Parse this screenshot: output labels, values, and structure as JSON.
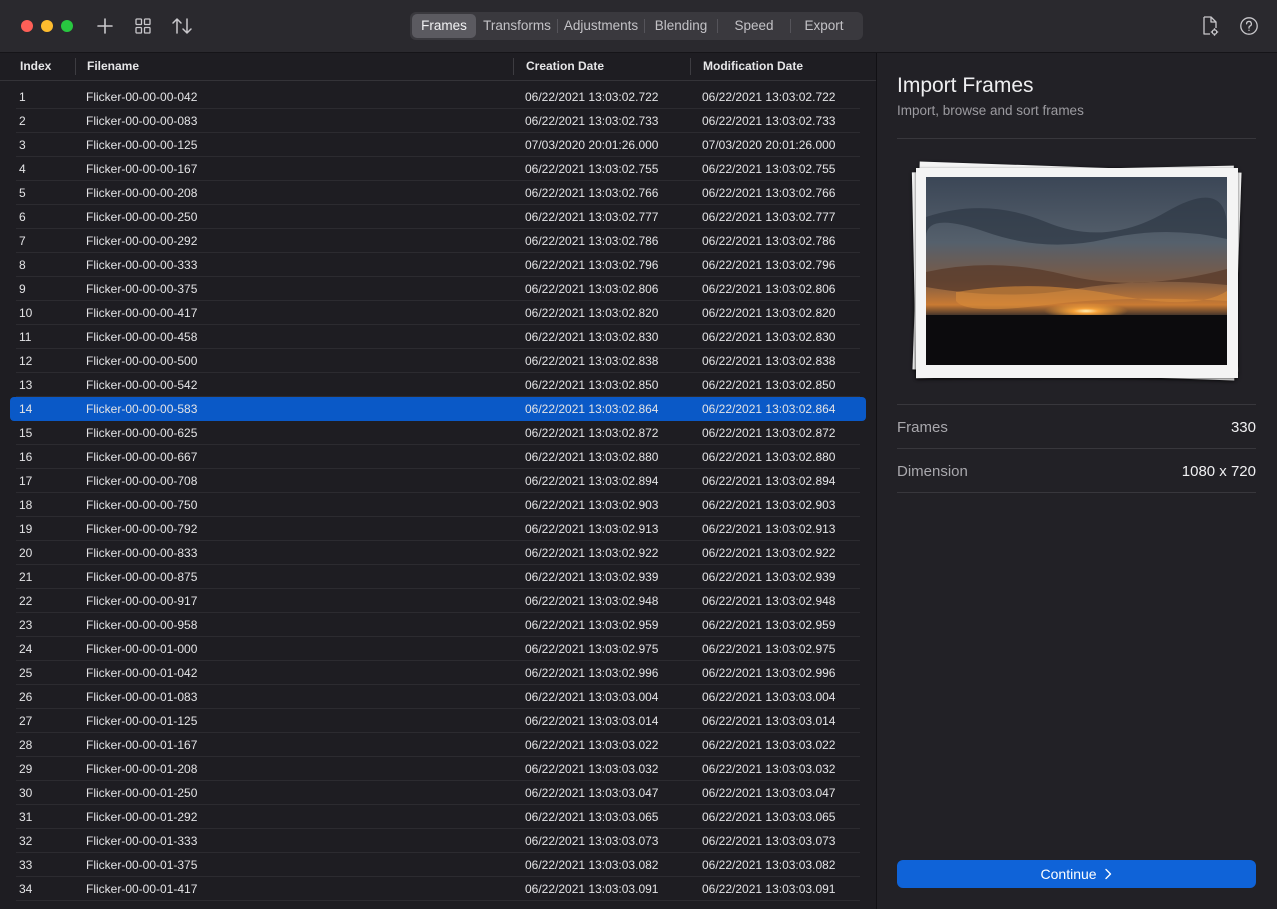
{
  "toolbar": {
    "tabs": [
      {
        "label": "Frames",
        "active": true
      },
      {
        "label": "Transforms",
        "active": false
      },
      {
        "label": "Adjustments",
        "active": false
      },
      {
        "label": "Blending",
        "active": false
      },
      {
        "label": "Speed",
        "active": false
      },
      {
        "label": "Export",
        "active": false
      }
    ],
    "icons": [
      "add-icon",
      "grid-icon",
      "sort-icon",
      "document-settings-icon",
      "help-icon"
    ]
  },
  "table": {
    "columns": [
      "Index",
      "Filename",
      "Creation Date",
      "Modification Date"
    ],
    "selected_index": "14",
    "rows": [
      [
        "1",
        "Flicker-00-00-00-042",
        "06/22/2021 13:03:02.722",
        "06/22/2021 13:03:02.722"
      ],
      [
        "2",
        "Flicker-00-00-00-083",
        "06/22/2021 13:03:02.733",
        "06/22/2021 13:03:02.733"
      ],
      [
        "3",
        "Flicker-00-00-00-125",
        "07/03/2020 20:01:26.000",
        "07/03/2020 20:01:26.000"
      ],
      [
        "4",
        "Flicker-00-00-00-167",
        "06/22/2021 13:03:02.755",
        "06/22/2021 13:03:02.755"
      ],
      [
        "5",
        "Flicker-00-00-00-208",
        "06/22/2021 13:03:02.766",
        "06/22/2021 13:03:02.766"
      ],
      [
        "6",
        "Flicker-00-00-00-250",
        "06/22/2021 13:03:02.777",
        "06/22/2021 13:03:02.777"
      ],
      [
        "7",
        "Flicker-00-00-00-292",
        "06/22/2021 13:03:02.786",
        "06/22/2021 13:03:02.786"
      ],
      [
        "8",
        "Flicker-00-00-00-333",
        "06/22/2021 13:03:02.796",
        "06/22/2021 13:03:02.796"
      ],
      [
        "9",
        "Flicker-00-00-00-375",
        "06/22/2021 13:03:02.806",
        "06/22/2021 13:03:02.806"
      ],
      [
        "10",
        "Flicker-00-00-00-417",
        "06/22/2021 13:03:02.820",
        "06/22/2021 13:03:02.820"
      ],
      [
        "11",
        "Flicker-00-00-00-458",
        "06/22/2021 13:03:02.830",
        "06/22/2021 13:03:02.830"
      ],
      [
        "12",
        "Flicker-00-00-00-500",
        "06/22/2021 13:03:02.838",
        "06/22/2021 13:03:02.838"
      ],
      [
        "13",
        "Flicker-00-00-00-542",
        "06/22/2021 13:03:02.850",
        "06/22/2021 13:03:02.850"
      ],
      [
        "14",
        "Flicker-00-00-00-583",
        "06/22/2021 13:03:02.864",
        "06/22/2021 13:03:02.864"
      ],
      [
        "15",
        "Flicker-00-00-00-625",
        "06/22/2021 13:03:02.872",
        "06/22/2021 13:03:02.872"
      ],
      [
        "16",
        "Flicker-00-00-00-667",
        "06/22/2021 13:03:02.880",
        "06/22/2021 13:03:02.880"
      ],
      [
        "17",
        "Flicker-00-00-00-708",
        "06/22/2021 13:03:02.894",
        "06/22/2021 13:03:02.894"
      ],
      [
        "18",
        "Flicker-00-00-00-750",
        "06/22/2021 13:03:02.903",
        "06/22/2021 13:03:02.903"
      ],
      [
        "19",
        "Flicker-00-00-00-792",
        "06/22/2021 13:03:02.913",
        "06/22/2021 13:03:02.913"
      ],
      [
        "20",
        "Flicker-00-00-00-833",
        "06/22/2021 13:03:02.922",
        "06/22/2021 13:03:02.922"
      ],
      [
        "21",
        "Flicker-00-00-00-875",
        "06/22/2021 13:03:02.939",
        "06/22/2021 13:03:02.939"
      ],
      [
        "22",
        "Flicker-00-00-00-917",
        "06/22/2021 13:03:02.948",
        "06/22/2021 13:03:02.948"
      ],
      [
        "23",
        "Flicker-00-00-00-958",
        "06/22/2021 13:03:02.959",
        "06/22/2021 13:03:02.959"
      ],
      [
        "24",
        "Flicker-00-00-01-000",
        "06/22/2021 13:03:02.975",
        "06/22/2021 13:03:02.975"
      ],
      [
        "25",
        "Flicker-00-00-01-042",
        "06/22/2021 13:03:02.996",
        "06/22/2021 13:03:02.996"
      ],
      [
        "26",
        "Flicker-00-00-01-083",
        "06/22/2021 13:03:03.004",
        "06/22/2021 13:03:03.004"
      ],
      [
        "27",
        "Flicker-00-00-01-125",
        "06/22/2021 13:03:03.014",
        "06/22/2021 13:03:03.014"
      ],
      [
        "28",
        "Flicker-00-00-01-167",
        "06/22/2021 13:03:03.022",
        "06/22/2021 13:03:03.022"
      ],
      [
        "29",
        "Flicker-00-00-01-208",
        "06/22/2021 13:03:03.032",
        "06/22/2021 13:03:03.032"
      ],
      [
        "30",
        "Flicker-00-00-01-250",
        "06/22/2021 13:03:03.047",
        "06/22/2021 13:03:03.047"
      ],
      [
        "31",
        "Flicker-00-00-01-292",
        "06/22/2021 13:03:03.065",
        "06/22/2021 13:03:03.065"
      ],
      [
        "32",
        "Flicker-00-00-01-333",
        "06/22/2021 13:03:03.073",
        "06/22/2021 13:03:03.073"
      ],
      [
        "33",
        "Flicker-00-00-01-375",
        "06/22/2021 13:03:03.082",
        "06/22/2021 13:03:03.082"
      ],
      [
        "34",
        "Flicker-00-00-01-417",
        "06/22/2021 13:03:03.091",
        "06/22/2021 13:03:03.091"
      ]
    ]
  },
  "sidebar": {
    "title": "Import Frames",
    "subtitle": "Import, browse and sort frames",
    "frames_label": "Frames",
    "frames_value": "330",
    "dimension_label": "Dimension",
    "dimension_value": "1080 x 720",
    "continue_label": "Continue"
  },
  "colors": {
    "accent": "#0a59c7",
    "button": "#0f63d8",
    "background": "#1e1d22"
  }
}
